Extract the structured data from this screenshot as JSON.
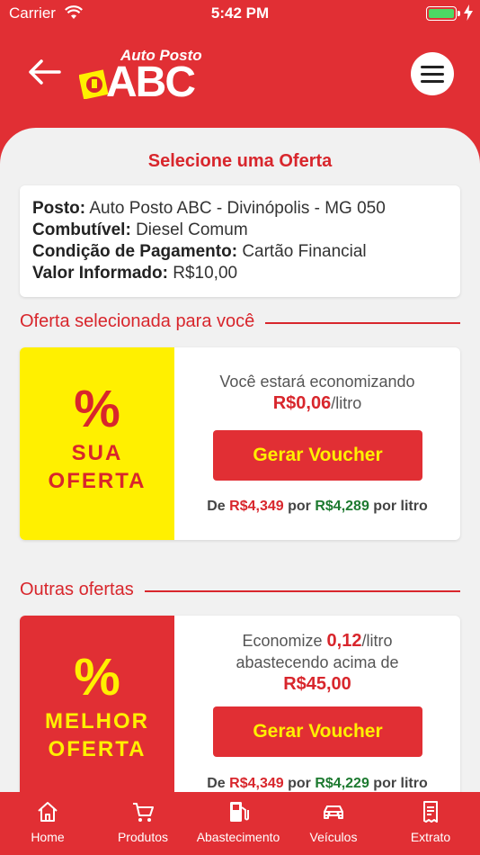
{
  "status_bar": {
    "carrier": "Carrier",
    "time": "5:42 PM"
  },
  "header": {
    "logo_top": "Auto Posto",
    "logo_main": "ABC",
    "colors": {
      "brand_red": "#e12f34",
      "brand_yellow": "#fff000"
    }
  },
  "page": {
    "title": "Selecione uma Oferta"
  },
  "info": {
    "posto_label": "Posto:",
    "posto_value": "Auto Posto ABC - Divinópolis - MG 050",
    "combustivel_label": "Combutível:",
    "combustivel_value": "Diesel Comum",
    "pagamento_label": "Condição de Pagamento:",
    "pagamento_value": "Cartão Financial",
    "valor_label": "Valor Informado:",
    "valor_value": "R$10,00"
  },
  "selected_section": {
    "label": "Oferta selecionada para você"
  },
  "selected_offer": {
    "badge_pct": "%",
    "badge_line1": "SUA",
    "badge_line2": "OFERTA",
    "desc": "Você estará economizando",
    "amount": "R$0,06",
    "unit": "/litro",
    "button": "Gerar Voucher",
    "price_prefix": "De",
    "old_price": "R$4,349",
    "price_mid": "por",
    "new_price": "R$4,289",
    "price_suffix": "por litro"
  },
  "others_section": {
    "label": "Outras ofertas"
  },
  "other_offer": {
    "badge_pct": "%",
    "badge_line1": "MELHOR",
    "badge_line2": "OFERTA",
    "desc_prefix": "Economize",
    "amount": "0,12",
    "unit": "/litro",
    "desc_line2": "abastecendo acima de",
    "threshold": "R$45,00",
    "button": "Gerar Voucher",
    "price_prefix": "De",
    "old_price": "R$4,349",
    "price_mid": "por",
    "new_price": "R$4,229",
    "price_suffix": "por litro"
  },
  "tabbar": {
    "items": [
      {
        "label": "Home",
        "icon": "home-icon"
      },
      {
        "label": "Produtos",
        "icon": "cart-icon"
      },
      {
        "label": "Abastecimento",
        "icon": "fuel-pump-icon"
      },
      {
        "label": "Veículos",
        "icon": "car-icon"
      },
      {
        "label": "Extrato",
        "icon": "receipt-icon"
      }
    ]
  }
}
